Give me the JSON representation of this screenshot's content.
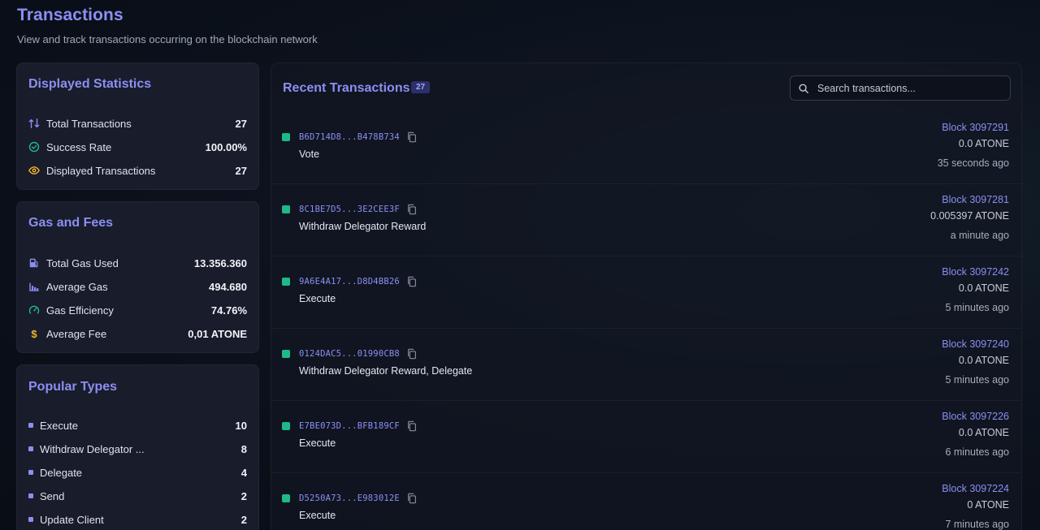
{
  "header": {
    "title": "Transactions",
    "subtitle": "View and track transactions occurring on the blockchain network"
  },
  "displayed_statistics": {
    "title": "Displayed Statistics",
    "rows": [
      {
        "label": "Total Transactions",
        "value": "27",
        "icon": "arrows-swap-icon"
      },
      {
        "label": "Success Rate",
        "value": "100.00%",
        "icon": "check-circle-icon"
      },
      {
        "label": "Displayed Transactions",
        "value": "27",
        "icon": "eye-icon"
      }
    ]
  },
  "gas_and_fees": {
    "title": "Gas and Fees",
    "rows": [
      {
        "label": "Total Gas Used",
        "value": "13.356.360",
        "icon": "fuel-pump-icon"
      },
      {
        "label": "Average Gas",
        "value": "494.680",
        "icon": "bar-chart-icon"
      },
      {
        "label": "Gas Efficiency",
        "value": "74.76%",
        "icon": "gauge-icon"
      },
      {
        "label": "Average Fee",
        "value": "0,01 ATONE",
        "icon": "dollar-icon"
      }
    ]
  },
  "popular_types": {
    "title": "Popular Types",
    "rows": [
      {
        "label": "Execute",
        "value": "10"
      },
      {
        "label": "Withdraw Delegator ...",
        "value": "8"
      },
      {
        "label": "Delegate",
        "value": "4"
      },
      {
        "label": "Send",
        "value": "2"
      },
      {
        "label": "Update Client",
        "value": "2"
      }
    ]
  },
  "recent_transactions": {
    "title": "Recent Transactions",
    "count": "27",
    "search_placeholder": "Search transactions...",
    "items": [
      {
        "hash": "B6D714D8...B478B734",
        "type": "Vote",
        "block": "Block 3097291",
        "amount": "0.0 ATONE",
        "time": "35 seconds ago"
      },
      {
        "hash": "8C1BE7D5...3E2CEE3F",
        "type": "Withdraw Delegator Reward",
        "block": "Block 3097281",
        "amount": "0.005397 ATONE",
        "time": "a minute ago"
      },
      {
        "hash": "9A6E4A17...D8D4BB26",
        "type": "Execute",
        "block": "Block 3097242",
        "amount": "0.0 ATONE",
        "time": "5 minutes ago"
      },
      {
        "hash": "0124DAC5...01990CB8",
        "type": "Withdraw Delegator Reward, Delegate",
        "block": "Block 3097240",
        "amount": "0.0 ATONE",
        "time": "5 minutes ago"
      },
      {
        "hash": "E7BE073D...BFB189CF",
        "type": "Execute",
        "block": "Block 3097226",
        "amount": "0.0 ATONE",
        "time": "6 minutes ago"
      },
      {
        "hash": "D5250A73...E983012E",
        "type": "Execute",
        "block": "Block 3097224",
        "amount": "0 ATONE",
        "time": "7 minutes ago"
      }
    ]
  },
  "colors": {
    "accent": "#8b8ff2",
    "success": "#1fb889",
    "warning": "#f0b429"
  }
}
